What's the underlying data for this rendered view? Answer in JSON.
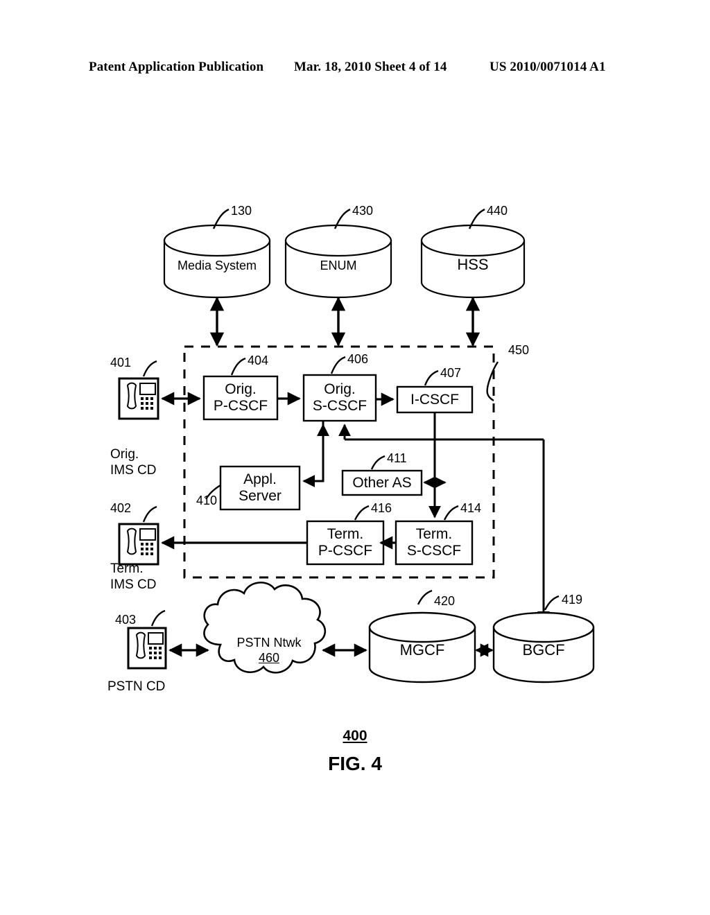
{
  "header": {
    "left": "Patent Application Publication",
    "middle": "Mar. 18, 2010  Sheet 4 of 14",
    "right": "US 2010/0071014 A1"
  },
  "caption": {
    "figure_number": "400",
    "figure_label": "FIG. 4"
  },
  "datastores": [
    {
      "id": "media-system",
      "label": "Media System",
      "ref": "130"
    },
    {
      "id": "enum",
      "label": "ENUM",
      "ref": "430"
    },
    {
      "id": "hss",
      "label": "HSS",
      "ref": "440"
    }
  ],
  "network_boundary": {
    "ref": "450"
  },
  "devices": [
    {
      "id": "orig-ims-cd",
      "ref": "401",
      "caption_line1": "Orig.",
      "caption_line2": "IMS CD",
      "icon": "desk-phone-icon"
    },
    {
      "id": "term-ims-cd",
      "ref": "402",
      "caption_line1": "Term.",
      "caption_line2": "IMS CD",
      "icon": "desk-phone-icon"
    },
    {
      "id": "pstn-cd",
      "ref": "403",
      "caption_line1": "PSTN CD",
      "caption_line2": "",
      "icon": "desk-phone-icon"
    }
  ],
  "nodes": [
    {
      "id": "orig-p-cscf",
      "line1": "Orig.",
      "line2": "P-CSCF",
      "ref": "404"
    },
    {
      "id": "orig-s-cscf",
      "line1": "Orig.",
      "line2": "S-CSCF",
      "ref": "406"
    },
    {
      "id": "i-cscf",
      "line1": "I-CSCF",
      "line2": "",
      "ref": "407"
    },
    {
      "id": "appl-server",
      "line1": "Appl.",
      "line2": "Server",
      "ref": "410"
    },
    {
      "id": "other-as",
      "line1": "Other AS",
      "line2": "",
      "ref": "411"
    },
    {
      "id": "term-p-cscf",
      "line1": "Term.",
      "line2": "P-CSCF",
      "ref": "416"
    },
    {
      "id": "term-s-cscf",
      "line1": "Term.",
      "line2": "S-CSCF",
      "ref": "414"
    }
  ],
  "cloud": {
    "id": "pstn-network",
    "line1": "PSTN Ntwk",
    "ref": "460"
  },
  "gateways": [
    {
      "id": "mgcf",
      "label": "MGCF",
      "ref": "420"
    },
    {
      "id": "bgcf",
      "label": "BGCF",
      "ref": "419"
    }
  ],
  "colors": {
    "ink": "#000000",
    "paper": "#ffffff"
  }
}
